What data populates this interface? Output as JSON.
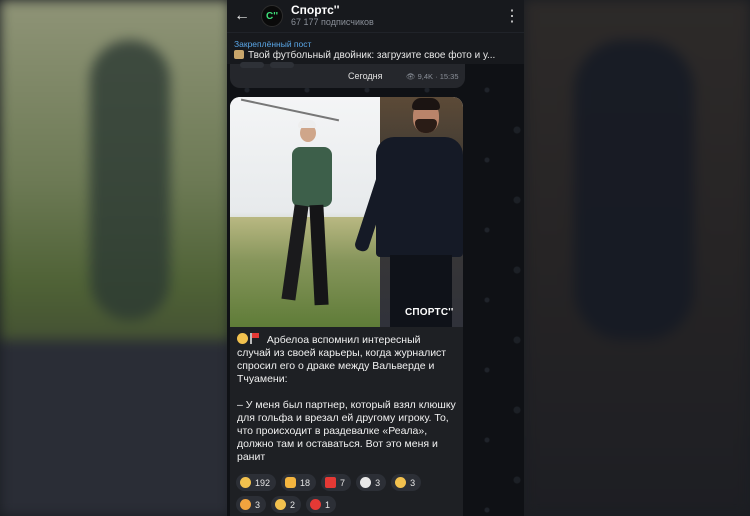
{
  "header": {
    "channel_name": "Спортс''",
    "subscribers": "67 177 подписчиков",
    "avatar_text": "С''"
  },
  "pinned": {
    "title": "Закреплённый пост",
    "text": "Твой футбольный двойник: загрузите свое фото и у..."
  },
  "prev_message": {
    "date_label": "Сегодня",
    "meta": "9,4K · 15:35"
  },
  "post": {
    "watermark": "СПОРТС''",
    "line1": "Арбелоа вспомнил интересный случай из своей карьеры, когда журналист спросил его о драке между Вальверде и Тчуамени:",
    "line2": "– У меня был партнер, который взял клюшку для гольфа и врезал ей другому игроку. То, что происходит в раздевалке «Реала», должно там и оставаться. Вот это меня и ранит"
  },
  "reactions": [
    {
      "icon": "smiling-face-hearts",
      "color": "#f2c14e",
      "count": "192"
    },
    {
      "icon": "thumbs-up",
      "color": "#f4b53f",
      "count": "18"
    },
    {
      "icon": "hundred",
      "color": "#e53935",
      "count": "7"
    },
    {
      "icon": "skull",
      "color": "#e8e8e8",
      "count": "3"
    },
    {
      "icon": "grimace-face",
      "color": "#f2c14e",
      "count": "3"
    },
    {
      "icon": "party-face",
      "color": "#f2a33e",
      "count": "3"
    },
    {
      "icon": "heart-eyes",
      "color": "#f2c14e",
      "count": "2"
    },
    {
      "icon": "red-heart",
      "color": "#e53935",
      "count": "1"
    }
  ]
}
